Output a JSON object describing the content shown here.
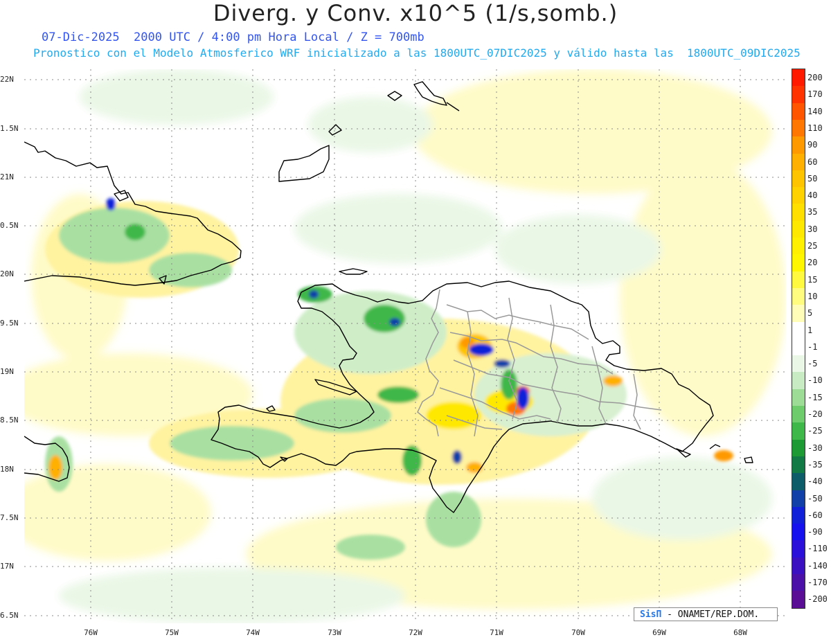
{
  "header": {
    "title": "Diverg. y Conv. x10^5 (1/s,somb.)",
    "line1": "07-Dic-2025  2000 UTC / 4:00 pm Hora Local / Z = 700mb",
    "line2": "Pronostico con el Modelo Atmosferico WRF inicializado a las 1800UTC_07DIC2025 y válido hasta las  1800UTC_09DIC2025"
  },
  "axes": {
    "lat_labels": [
      "22N",
      "1.5N",
      "21N",
      "0.5N",
      "20N",
      "9.5N",
      "19N",
      "8.5N",
      "18N",
      "7.5N",
      "17N",
      "6.5N"
    ],
    "lon_labels": [
      "76W",
      "75W",
      "74W",
      "73W",
      "72W",
      "71W",
      "70W",
      "69W",
      "68W"
    ]
  },
  "colorbar": {
    "labels": [
      "200",
      "170",
      "140",
      "110",
      "90",
      "60",
      "50",
      "40",
      "35",
      "30",
      "25",
      "20",
      "15",
      "10",
      "5",
      "1",
      "-1",
      "-5",
      "-10",
      "-15",
      "-20",
      "-25",
      "-30",
      "-35",
      "-40",
      "-50",
      "-60",
      "-90",
      "-110",
      "-140",
      "-170",
      "-200"
    ],
    "colors": [
      "#ff1a00",
      "#ff3300",
      "#ff5500",
      "#ff7700",
      "#ff9900",
      "#ffb000",
      "#ffc400",
      "#ffd200",
      "#ffdf00",
      "#ffe800",
      "#fff000",
      "#fff600",
      "#fffa40",
      "#fffc80",
      "#fffdb8",
      "#ffffff",
      "#ffffff",
      "#eaf7e6",
      "#c8ebc4",
      "#9ddc97",
      "#6ecc6c",
      "#3fb84a",
      "#1e9a35",
      "#127a45",
      "#0d5c6a",
      "#1040a8",
      "#1020d8",
      "#1410ee",
      "#2a10d8",
      "#3a10c0",
      "#4a10a8",
      "#5a0e96"
    ]
  },
  "credit": {
    "logo": "SisΠ",
    "text": "- ONAMET/REP.DOM."
  },
  "map": {
    "land_color": "#000000",
    "border_color": "#999999"
  }
}
